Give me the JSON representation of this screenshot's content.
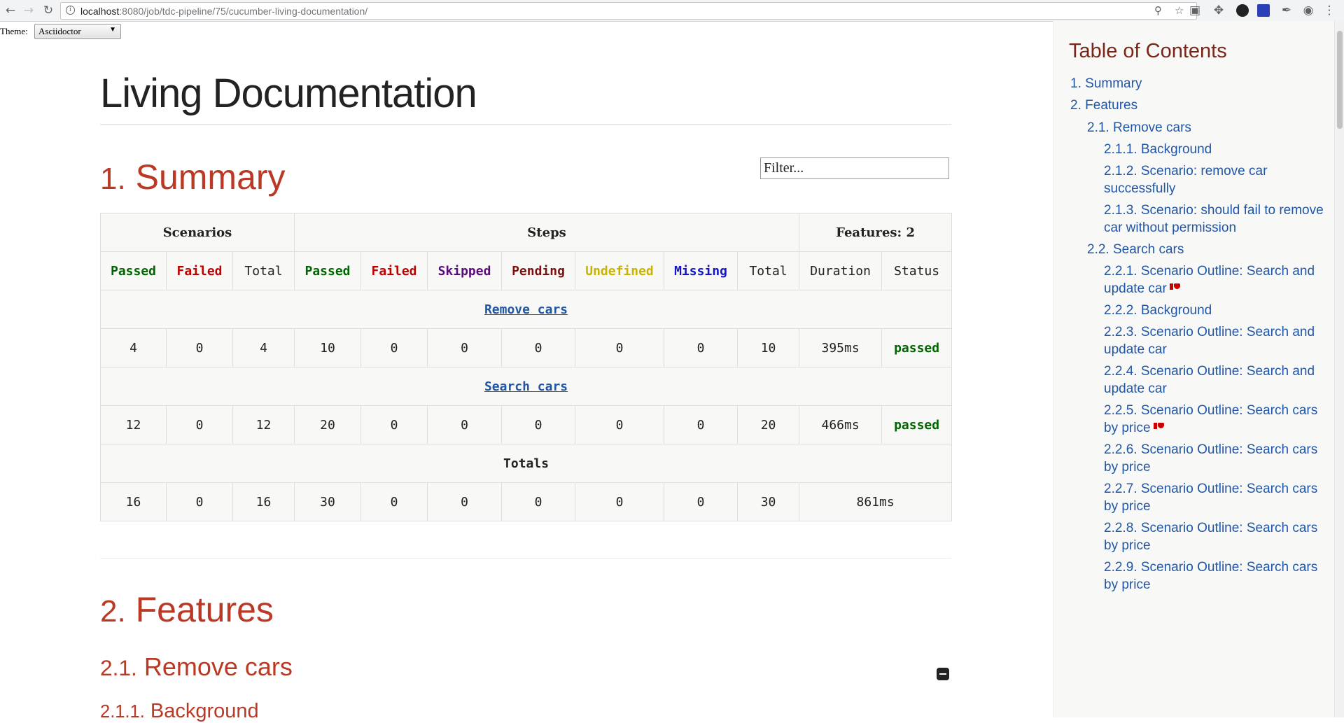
{
  "browser": {
    "url_host": "localhost",
    "url_rest": ":8080/job/tdc-pipeline/75/cucumber-living-documentation/"
  },
  "theme": {
    "label": "Theme:",
    "selected": "Asciidoctor"
  },
  "doc": {
    "title": "Living Documentation",
    "summary_heading": {
      "num": "1.",
      "text": "Summary"
    },
    "features_heading": {
      "num": "2.",
      "text": "Features"
    },
    "remove_cars_heading": {
      "num": "2.1.",
      "text": "Remove cars"
    },
    "background_heading": {
      "num": "2.1.1.",
      "text": "Background"
    },
    "filter_placeholder": "Filter..."
  },
  "summary_table": {
    "group_headers": {
      "scenarios": "Scenarios",
      "steps": "Steps",
      "features": "Features: 2"
    },
    "columns": [
      "Passed",
      "Failed",
      "Total",
      "Passed",
      "Failed",
      "Skipped",
      "Pending",
      "Undefined",
      "Missing",
      "Total",
      "Duration",
      "Status"
    ],
    "features": [
      {
        "name": "Remove cars",
        "values": [
          "4",
          "0",
          "4",
          "10",
          "0",
          "0",
          "0",
          "0",
          "0",
          "10",
          "395ms"
        ],
        "status": "passed"
      },
      {
        "name": "Search cars",
        "values": [
          "12",
          "0",
          "12",
          "20",
          "0",
          "0",
          "0",
          "0",
          "0",
          "20",
          "466ms"
        ],
        "status": "passed"
      }
    ],
    "totals_label": "Totals",
    "totals": [
      "16",
      "0",
      "16",
      "30",
      "0",
      "0",
      "0",
      "0",
      "0",
      "30",
      "861ms"
    ]
  },
  "toc": {
    "title": "Table of Contents",
    "items": [
      {
        "num": "1.",
        "text": "Summary",
        "level": 1
      },
      {
        "num": "2.",
        "text": "Features",
        "level": 1
      },
      {
        "num": "2.1.",
        "text": "Remove cars",
        "level": 2
      },
      {
        "num": "2.1.1.",
        "text": "Background",
        "level": 3
      },
      {
        "num": "2.1.2.",
        "text": "Scenario: remove car successfully",
        "level": 3
      },
      {
        "num": "2.1.3.",
        "text": "Scenario: should fail to remove car without permission",
        "level": 3
      },
      {
        "num": "2.2.",
        "text": "Search cars",
        "level": 2
      },
      {
        "num": "2.2.1.",
        "text": "Scenario Outline: Search and update car",
        "level": 3,
        "failed": true
      },
      {
        "num": "2.2.2.",
        "text": "Background",
        "level": 3
      },
      {
        "num": "2.2.3.",
        "text": "Scenario Outline: Search and update car",
        "level": 3
      },
      {
        "num": "2.2.4.",
        "text": "Scenario Outline: Search and update car",
        "level": 3
      },
      {
        "num": "2.2.5.",
        "text": "Scenario Outline: Search cars by price",
        "level": 3,
        "failed": true
      },
      {
        "num": "2.2.6.",
        "text": "Scenario Outline: Search cars by price",
        "level": 3
      },
      {
        "num": "2.2.7.",
        "text": "Scenario Outline: Search cars by price",
        "level": 3
      },
      {
        "num": "2.2.8.",
        "text": "Scenario Outline: Search cars by price",
        "level": 3
      },
      {
        "num": "2.2.9.",
        "text": "Scenario Outline: Search cars by price",
        "level": 3
      }
    ]
  },
  "colors": {
    "heading": "#ba3925",
    "link": "#2156a5",
    "passed": "#006400",
    "failed": "#c00000"
  }
}
